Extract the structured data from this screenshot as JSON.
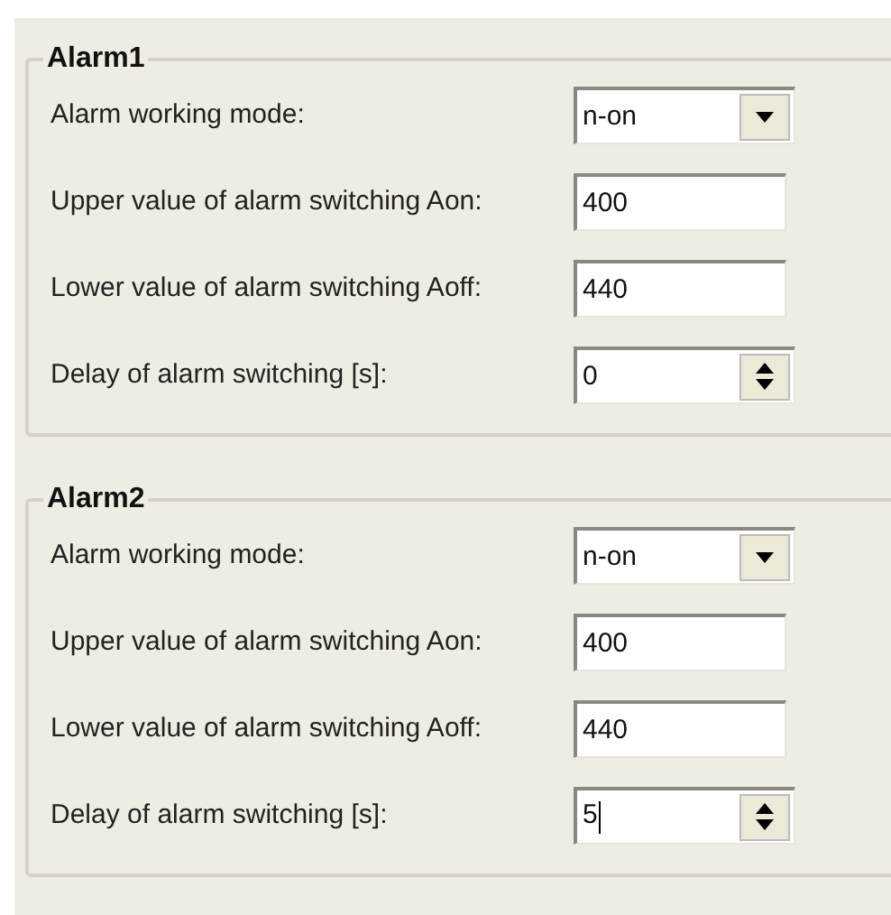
{
  "groups": [
    {
      "title": "Alarm1",
      "rows": [
        {
          "kind": "select",
          "label": "Alarm working mode:",
          "value": "n-on"
        },
        {
          "kind": "text",
          "label": "Upper value of alarm switching Aon:",
          "value": "400"
        },
        {
          "kind": "text",
          "label": "Lower value of alarm switching Aoff:",
          "value": "440"
        },
        {
          "kind": "spin",
          "label": "Delay of alarm switching [s]:",
          "value": "0",
          "focused": false
        }
      ]
    },
    {
      "title": "Alarm2",
      "rows": [
        {
          "kind": "select",
          "label": "Alarm working mode:",
          "value": "n-on"
        },
        {
          "kind": "text",
          "label": "Upper value of alarm switching Aon:",
          "value": "400"
        },
        {
          "kind": "text",
          "label": "Lower value of alarm switching Aoff:",
          "value": "440"
        },
        {
          "kind": "spin",
          "label": "Delay of alarm switching [s]:",
          "value": "5",
          "focused": true
        }
      ]
    }
  ]
}
